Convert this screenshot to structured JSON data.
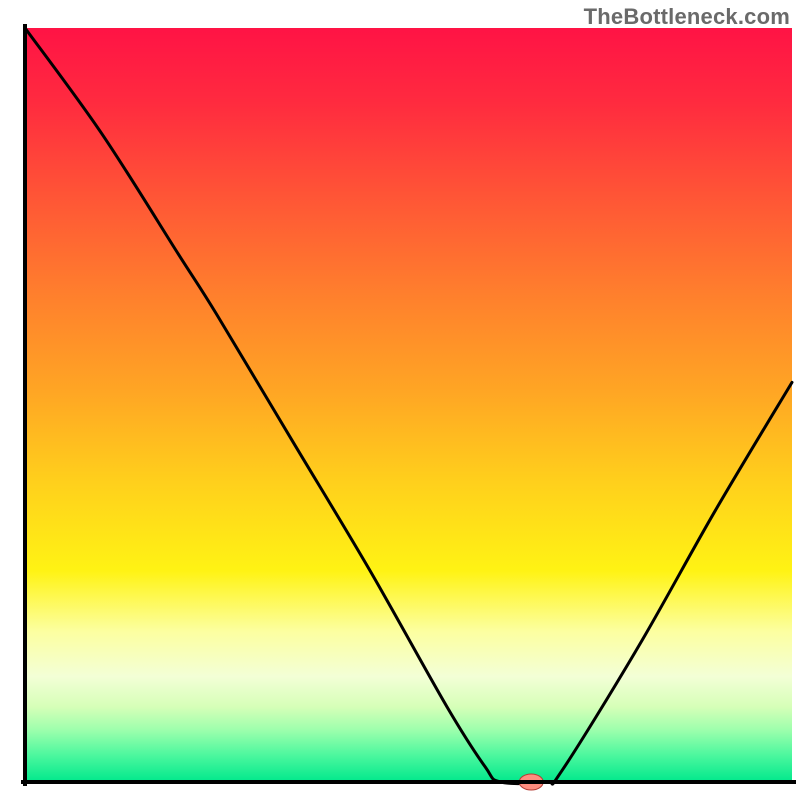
{
  "watermark": "TheBottleneck.com",
  "chart_data": {
    "type": "line",
    "title": "",
    "xlabel": "",
    "ylabel": "",
    "x_range": [
      0,
      100
    ],
    "y_range": [
      0,
      100
    ],
    "curve_points": [
      {
        "x": 0.0,
        "y": 100.0
      },
      {
        "x": 10.0,
        "y": 86.0
      },
      {
        "x": 20.0,
        "y": 70.0
      },
      {
        "x": 25.0,
        "y": 62.0
      },
      {
        "x": 35.0,
        "y": 45.0
      },
      {
        "x": 45.0,
        "y": 28.0
      },
      {
        "x": 55.0,
        "y": 10.0
      },
      {
        "x": 60.0,
        "y": 2.0
      },
      {
        "x": 62.0,
        "y": 0.0
      },
      {
        "x": 68.0,
        "y": 0.0
      },
      {
        "x": 70.0,
        "y": 1.5
      },
      {
        "x": 80.0,
        "y": 18.0
      },
      {
        "x": 90.0,
        "y": 36.0
      },
      {
        "x": 100.0,
        "y": 53.0
      }
    ],
    "marker": {
      "x": 66.0,
      "y": 0.0
    },
    "gradient_stops": [
      {
        "offset": 0.0,
        "color": "#ff1345"
      },
      {
        "offset": 0.1,
        "color": "#ff2b3f"
      },
      {
        "offset": 0.22,
        "color": "#ff5436"
      },
      {
        "offset": 0.35,
        "color": "#ff7e2d"
      },
      {
        "offset": 0.48,
        "color": "#ffa524"
      },
      {
        "offset": 0.6,
        "color": "#ffcf1c"
      },
      {
        "offset": 0.72,
        "color": "#fff314"
      },
      {
        "offset": 0.8,
        "color": "#fcffa0"
      },
      {
        "offset": 0.86,
        "color": "#f3ffd6"
      },
      {
        "offset": 0.9,
        "color": "#d6ffb8"
      },
      {
        "offset": 0.93,
        "color": "#9fffad"
      },
      {
        "offset": 0.965,
        "color": "#4bf79e"
      },
      {
        "offset": 1.0,
        "color": "#00e88c"
      }
    ],
    "marker_color": "#ff8d7f",
    "marker_stroke": "#b53d35",
    "curve_color": "#000000",
    "axis_color": "#000000",
    "background_color": "#ffffff"
  }
}
